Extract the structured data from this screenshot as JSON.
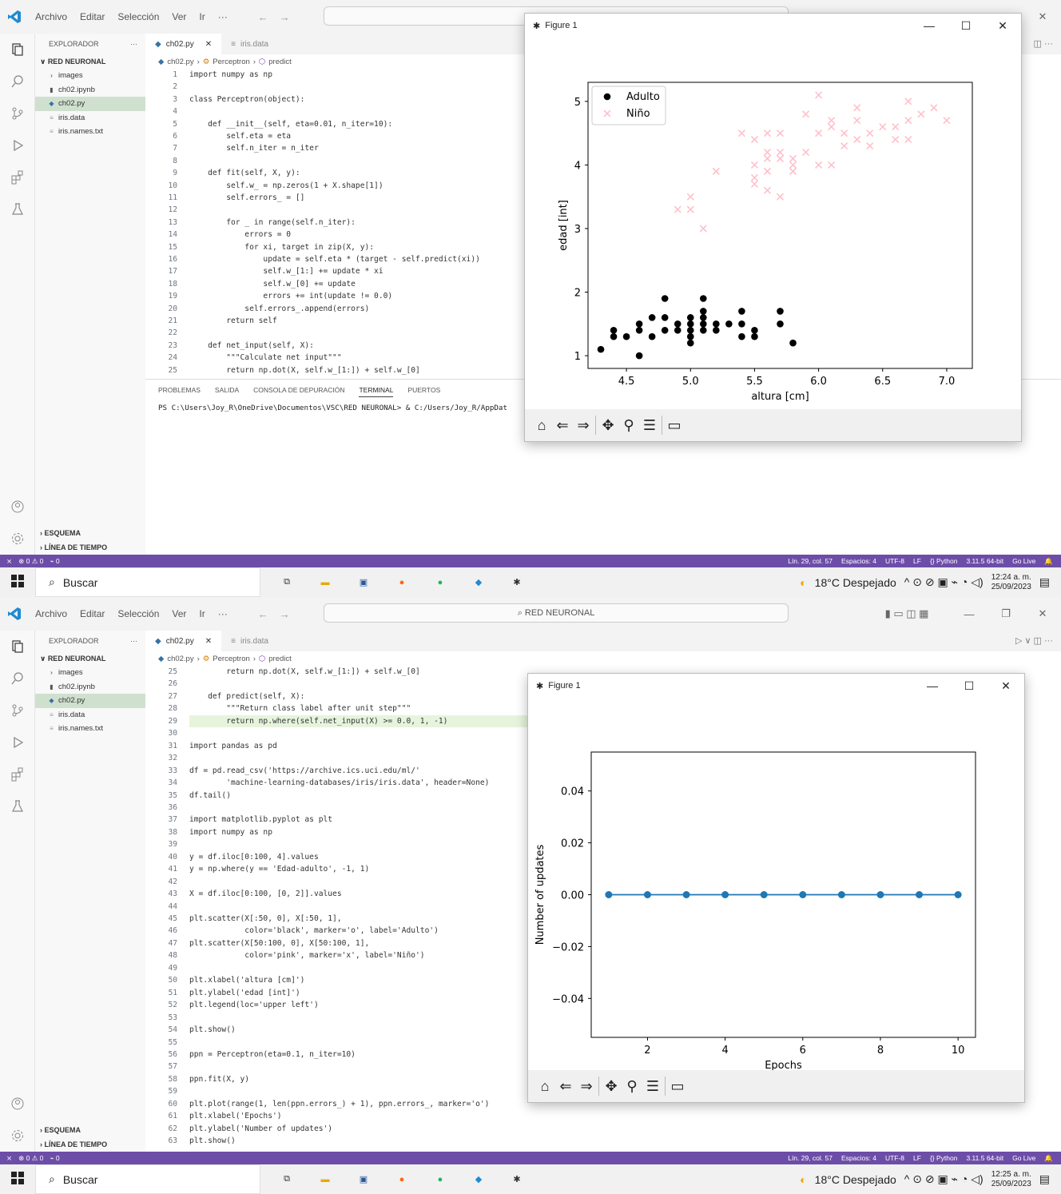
{
  "window": {
    "menu": [
      "Archivo",
      "Editar",
      "Selección",
      "Ver",
      "Ir",
      "···"
    ],
    "command_center": "RED NEURONAL"
  },
  "sidebar": {
    "title": "EXPLORADOR",
    "root": "RED NEURONAL",
    "items": [
      {
        "label": "images",
        "kind": "folder"
      },
      {
        "label": "ch02.ipynb",
        "kind": "notebook"
      },
      {
        "label": "ch02.py",
        "kind": "python"
      },
      {
        "label": "iris.data",
        "kind": "text"
      },
      {
        "label": "iris.names.txt",
        "kind": "text"
      }
    ],
    "outline": "ESQUEMA",
    "timeline": "LÍNEA DE TIEMPO"
  },
  "tabs": {
    "active": "ch02.py",
    "other": "iris.data"
  },
  "breadcrumb": [
    "ch02.py",
    "Perceptron",
    "predict"
  ],
  "editor1": {
    "start_line": 1,
    "lines": [
      "import numpy as np",
      "",
      "class Perceptron(object):",
      "",
      "    def __init__(self, eta=0.01, n_iter=10):",
      "        self.eta = eta",
      "        self.n_iter = n_iter",
      "",
      "    def fit(self, X, y):",
      "        self.w_ = np.zeros(1 + X.shape[1])",
      "        self.errors_ = []",
      "",
      "        for _ in range(self.n_iter):",
      "            errors = 0",
      "            for xi, target in zip(X, y):",
      "                update = self.eta * (target - self.predict(xi))",
      "                self.w_[1:] += update * xi",
      "                self.w_[0] += update",
      "                errors += int(update != 0.0)",
      "            self.errors_.append(errors)",
      "        return self",
      "",
      "    def net_input(self, X):",
      "        \"\"\"Calculate net input\"\"\"",
      "        return np.dot(X, self.w_[1:]) + self.w_[0]"
    ]
  },
  "editor2": {
    "start_line": 25,
    "highlight_line": 29,
    "lines": [
      "        return np.dot(X, self.w_[1:]) + self.w_[0]",
      "",
      "    def predict(self, X):",
      "        \"\"\"Return class label after unit step\"\"\"",
      "        return np.where(self.net_input(X) >= 0.0, 1, -1)",
      "",
      "import pandas as pd",
      "",
      "df = pd.read_csv('https://archive.ics.uci.edu/ml/'",
      "        'machine-learning-databases/iris/iris.data', header=None)",
      "df.tail()",
      "",
      "import matplotlib.pyplot as plt",
      "import numpy as np",
      "",
      "y = df.iloc[0:100, 4].values",
      "y = np.where(y == 'Edad-adulto', -1, 1)",
      "",
      "X = df.iloc[0:100, [0, 2]].values",
      "",
      "plt.scatter(X[:50, 0], X[:50, 1],",
      "            color='black', marker='o', label='Adulto')",
      "plt.scatter(X[50:100, 0], X[50:100, 1],",
      "            color='pink', marker='x', label='Niño')",
      "",
      "plt.xlabel('altura [cm]')",
      "plt.ylabel('edad [int]')",
      "plt.legend(loc='upper left')",
      "",
      "plt.show()",
      "",
      "ppn = Perceptron(eta=0.1, n_iter=10)",
      "",
      "ppn.fit(X, y)",
      "",
      "plt.plot(range(1, len(ppn.errors_) + 1), ppn.errors_, marker='o')",
      "plt.xlabel('Epochs')",
      "plt.ylabel('Number of updates')",
      "plt.show()"
    ]
  },
  "panel": {
    "tabs": [
      "PROBLEMAS",
      "SALIDA",
      "CONSOLA DE DEPURACIÓN",
      "TERMINAL",
      "PUERTOS"
    ],
    "active": "TERMINAL",
    "terminal_line": "PS C:\\Users\\Joy_R\\OneDrive\\Documentos\\VSC\\RED NEURONAL> & C:/Users/Joy_R/AppDat"
  },
  "statusbar": {
    "left": [
      "⊗ 0 ⚠ 0",
      "⌁ 0"
    ],
    "right": [
      "Lín. 29, col. 57",
      "Espacios: 4",
      "UTF-8",
      "LF",
      "{} Python",
      "3.11.5 64-bit",
      "Go Live"
    ]
  },
  "taskbar": {
    "search": "Buscar",
    "weather": "18°C  Despejado",
    "time1": "12:24 a. m.",
    "time2": "12:25 a. m.",
    "date": "25/09/2023"
  },
  "figure_title": "Figure 1",
  "chart_data": [
    {
      "type": "scatter",
      "xlabel": "altura [cm]",
      "ylabel": "edad [int]",
      "xlim": [
        4.2,
        7.2
      ],
      "ylim": [
        0.8,
        5.3
      ],
      "xticks": [
        4.5,
        5.0,
        5.5,
        6.0,
        6.5,
        7.0
      ],
      "yticks": [
        1,
        2,
        3,
        4,
        5
      ],
      "legend": "upper left",
      "series": [
        {
          "name": "Adulto",
          "marker": "o",
          "color": "#000000",
          "points": [
            [
              4.3,
              1.1
            ],
            [
              4.4,
              1.3
            ],
            [
              4.4,
              1.4
            ],
            [
              4.5,
              1.3
            ],
            [
              4.6,
              1.0
            ],
            [
              4.6,
              1.4
            ],
            [
              4.6,
              1.5
            ],
            [
              4.7,
              1.3
            ],
            [
              4.7,
              1.6
            ],
            [
              4.8,
              1.4
            ],
            [
              4.8,
              1.6
            ],
            [
              4.8,
              1.9
            ],
            [
              4.9,
              1.4
            ],
            [
              4.9,
              1.5
            ],
            [
              5.0,
              1.2
            ],
            [
              5.0,
              1.3
            ],
            [
              5.0,
              1.4
            ],
            [
              5.0,
              1.5
            ],
            [
              5.0,
              1.6
            ],
            [
              5.1,
              1.4
            ],
            [
              5.1,
              1.5
            ],
            [
              5.1,
              1.7
            ],
            [
              5.1,
              1.9
            ],
            [
              5.1,
              1.6
            ],
            [
              5.2,
              1.4
            ],
            [
              5.2,
              1.5
            ],
            [
              5.3,
              1.5
            ],
            [
              5.4,
              1.3
            ],
            [
              5.4,
              1.5
            ],
            [
              5.4,
              1.7
            ],
            [
              5.5,
              1.3
            ],
            [
              5.5,
              1.4
            ],
            [
              5.7,
              1.5
            ],
            [
              5.7,
              1.7
            ],
            [
              5.8,
              1.2
            ]
          ]
        },
        {
          "name": "Niño",
          "marker": "x",
          "color": "#ffc0cb",
          "points": [
            [
              4.9,
              3.3
            ],
            [
              5.0,
              3.3
            ],
            [
              5.0,
              3.5
            ],
            [
              5.1,
              3.0
            ],
            [
              5.2,
              3.9
            ],
            [
              5.4,
              4.5
            ],
            [
              5.5,
              3.7
            ],
            [
              5.5,
              3.8
            ],
            [
              5.5,
              4.0
            ],
            [
              5.5,
              4.4
            ],
            [
              5.6,
              3.6
            ],
            [
              5.6,
              3.9
            ],
            [
              5.6,
              4.1
            ],
            [
              5.6,
              4.2
            ],
            [
              5.6,
              4.5
            ],
            [
              5.7,
              3.5
            ],
            [
              5.7,
              4.1
            ],
            [
              5.7,
              4.2
            ],
            [
              5.7,
              4.5
            ],
            [
              5.8,
              3.9
            ],
            [
              5.8,
              4.0
            ],
            [
              5.8,
              4.1
            ],
            [
              5.9,
              4.2
            ],
            [
              5.9,
              4.8
            ],
            [
              6.0,
              4.0
            ],
            [
              6.0,
              4.5
            ],
            [
              6.0,
              5.1
            ],
            [
              6.1,
              4.0
            ],
            [
              6.1,
              4.6
            ],
            [
              6.1,
              4.7
            ],
            [
              6.2,
              4.3
            ],
            [
              6.2,
              4.5
            ],
            [
              6.3,
              4.4
            ],
            [
              6.3,
              4.7
            ],
            [
              6.3,
              4.9
            ],
            [
              6.4,
              4.3
            ],
            [
              6.4,
              4.5
            ],
            [
              6.5,
              4.6
            ],
            [
              6.6,
              4.4
            ],
            [
              6.6,
              4.6
            ],
            [
              6.7,
              4.4
            ],
            [
              6.7,
              4.7
            ],
            [
              6.7,
              5.0
            ],
            [
              6.8,
              4.8
            ],
            [
              6.9,
              4.9
            ],
            [
              7.0,
              4.7
            ]
          ]
        }
      ]
    },
    {
      "type": "line",
      "xlabel": "Epochs",
      "ylabel": "Number of updates",
      "xlim": [
        0.55,
        10.45
      ],
      "ylim": [
        -0.055,
        0.055
      ],
      "xticks": [
        2,
        4,
        6,
        8,
        10
      ],
      "yticks": [
        -0.04,
        -0.02,
        0.0,
        0.02,
        0.04
      ],
      "ytick_labels": [
        "−0.04",
        "−0.02",
        "0.00",
        "0.02",
        "0.04"
      ],
      "marker": "o",
      "color": "#1f77b4",
      "x": [
        1,
        2,
        3,
        4,
        5,
        6,
        7,
        8,
        9,
        10
      ],
      "y": [
        0,
        0,
        0,
        0,
        0,
        0,
        0,
        0,
        0,
        0
      ]
    }
  ]
}
